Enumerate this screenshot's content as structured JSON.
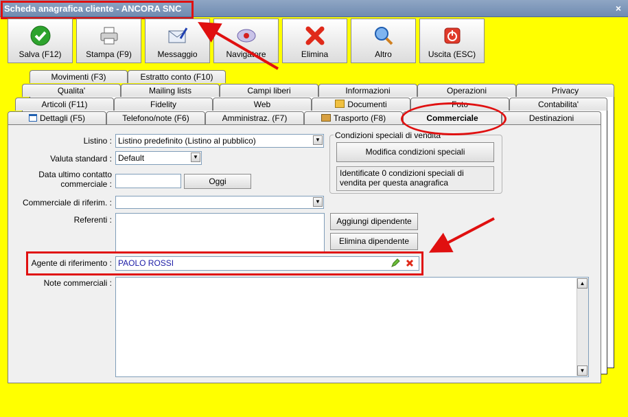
{
  "window": {
    "title": "Scheda anagrafica cliente - ANCORA SNC",
    "close_glyph": "×"
  },
  "toolbar": [
    {
      "label": "Salva (F12)",
      "icon": "check-icon"
    },
    {
      "label": "Stampa (F9)",
      "icon": "printer-icon"
    },
    {
      "label": "Messaggio",
      "icon": "envelope-pen-icon"
    },
    {
      "label": "Navigatore",
      "icon": "compass-icon"
    },
    {
      "label": "Elimina",
      "icon": "red-x-icon"
    },
    {
      "label": "Altro",
      "icon": "magnifier-icon"
    },
    {
      "label": "Uscita (ESC)",
      "icon": "power-icon"
    }
  ],
  "tabs": {
    "row1": [
      "Movimenti (F3)",
      "Estratto conto (F10)"
    ],
    "row2": [
      "Qualita'",
      "Mailing lists",
      "Campi liberi",
      "Informazioni",
      "Operazioni",
      "Privacy"
    ],
    "row3": [
      "Articoli (F11)",
      "Fidelity",
      "Web",
      "Documenti",
      "Foto",
      "Contabilita'"
    ],
    "row4": [
      "Dettagli (F5)",
      "Telefono/note (F6)",
      "Amministraz. (F7)",
      "Trasporto (F8)",
      "Commerciale",
      "Destinazioni"
    ]
  },
  "form": {
    "listino_label": "Listino :",
    "listino_value": "Listino predefinito (Listino al pubblico)",
    "valuta_label": "Valuta standard :",
    "valuta_value": "Default",
    "data_label_1": "Data ultimo contatto",
    "data_label_2": "commerciale :",
    "data_value": "",
    "oggi_button": "Oggi",
    "commerciale_label": "Commerciale di riferim. :",
    "commerciale_value": "",
    "referenti_label": "Referenti :",
    "aggiungi_button": "Aggiungi dipendente",
    "elimina_button": "Elimina dipendente",
    "agente_label": "Agente di riferimento :",
    "agente_value": "PAOLO ROSSI",
    "note_label": "Note commerciali :",
    "note_value": ""
  },
  "condizioni": {
    "title": "Condizioni speciali di vendita",
    "button": "Modifica condizioni speciali",
    "info": "Identificate 0 condizioni speciali di vendita per questa anagrafica"
  },
  "colors": {
    "background": "#ffff00",
    "annotation": "#e01010",
    "agent_text": "#1a1aa6"
  }
}
